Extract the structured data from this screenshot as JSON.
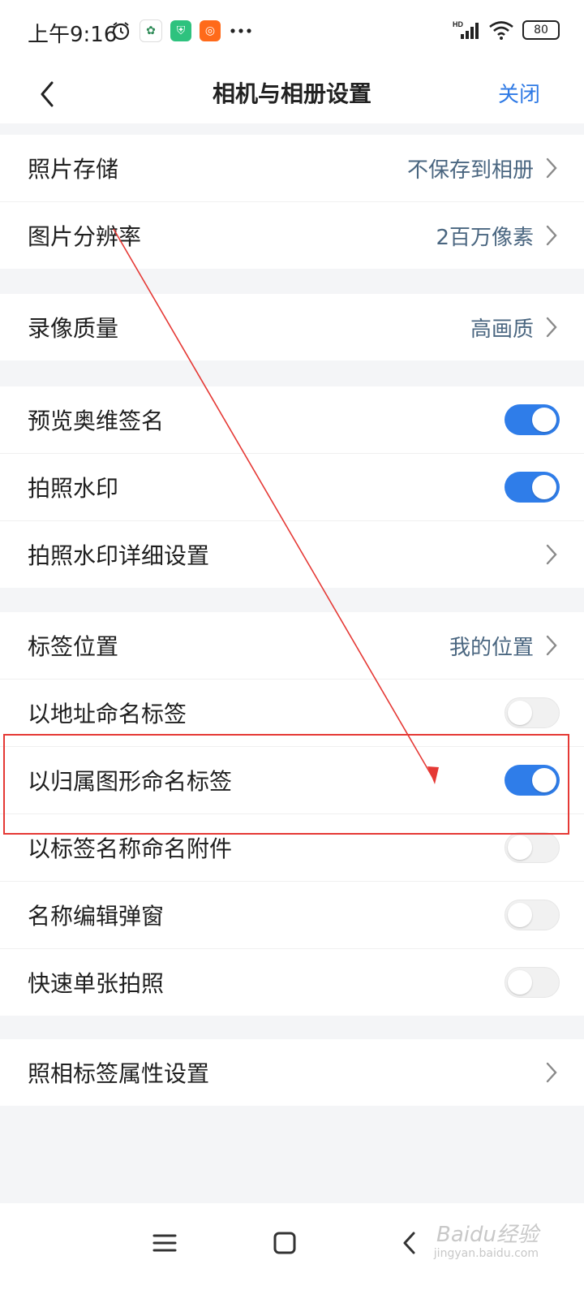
{
  "status_bar": {
    "time": "上午9:16",
    "battery": "80"
  },
  "nav": {
    "title": "相机与相册设置",
    "close_label": "关闭"
  },
  "group1": [
    {
      "label": "照片存储",
      "value": "不保存到相册"
    },
    {
      "label": "图片分辨率",
      "value": "2百万像素"
    }
  ],
  "group2": [
    {
      "label": "录像质量",
      "value": "高画质"
    }
  ],
  "group3": [
    {
      "label": "预览奥维签名",
      "toggle": true
    },
    {
      "label": "拍照水印",
      "toggle": true
    },
    {
      "label": "拍照水印详细设置"
    }
  ],
  "group4": [
    {
      "label": "标签位置",
      "value": "我的位置"
    },
    {
      "label": "以地址命名标签",
      "toggle": false
    },
    {
      "label": "以归属图形命名标签",
      "toggle": true
    },
    {
      "label": "以标签名称命名附件",
      "toggle": false
    },
    {
      "label": "名称编辑弹窗",
      "toggle": false
    },
    {
      "label": "快速单张拍照",
      "toggle": false
    }
  ],
  "group5": [
    {
      "label": "照相标签属性设置"
    }
  ],
  "watermark": {
    "text": "Baidu经验",
    "sub": "jingyan.baidu.com"
  },
  "colors": {
    "accent": "#2f7ae5",
    "value_text": "#4a6680",
    "annotation": "#e53935",
    "background": "#f4f5f7"
  }
}
